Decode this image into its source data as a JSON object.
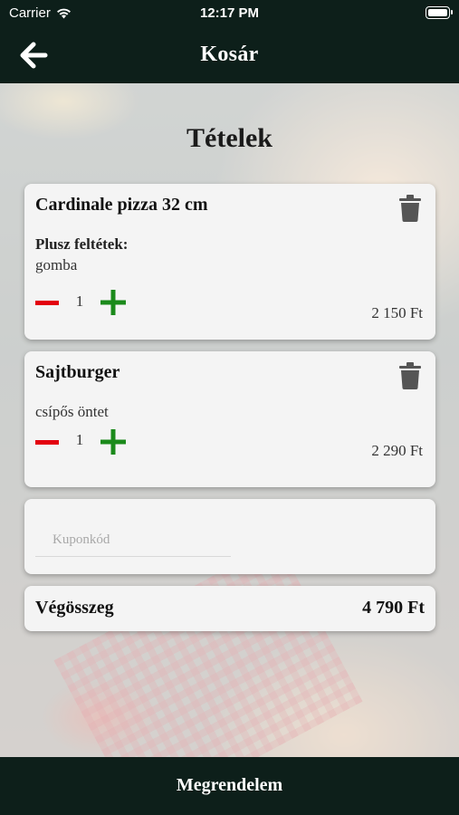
{
  "status_bar": {
    "carrier": "Carrier",
    "time": "12:17 PM",
    "battery_level": 1.0
  },
  "nav": {
    "title": "Kosár",
    "back_icon": "arrow-left-icon"
  },
  "section_title": "Tételek",
  "cart_items": [
    {
      "name": "Cardinale pizza 32 cm",
      "extras_title": "Plusz feltétek:",
      "extras_value": "gomba",
      "quantity": "1",
      "price": "2 150 Ft"
    },
    {
      "name": "Sajtburger",
      "extras_value": "csípős öntet",
      "quantity": "1",
      "price": "2 290 Ft"
    }
  ],
  "coupon": {
    "placeholder": "Kuponkód",
    "value": ""
  },
  "total": {
    "label": "Végösszeg",
    "value": "4 790 Ft"
  },
  "order_button": {
    "label": "Megrendelem"
  },
  "colors": {
    "bar_bg": "#0d1f1a",
    "minus": "#e3000f",
    "plus": "#1b8a1b",
    "trash": "#555555",
    "card_bg": "#f4f4f4"
  }
}
